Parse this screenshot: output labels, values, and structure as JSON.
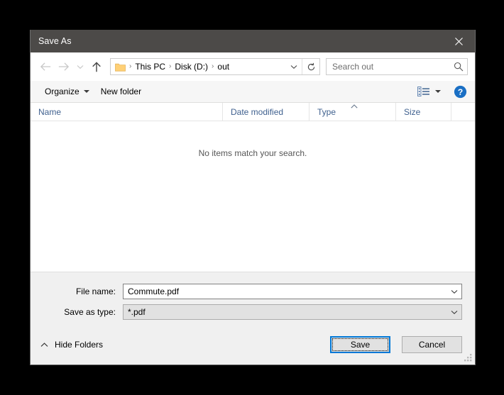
{
  "dialog": {
    "title": "Save As",
    "close_label": "Close"
  },
  "nav": {
    "back": "Back",
    "forward": "Forward",
    "recent": "Recent locations",
    "up": "Up one level"
  },
  "address": {
    "folder_icon": "folder-icon",
    "crumbs": [
      "This PC",
      "Disk (D:)",
      "out"
    ],
    "separator": "›",
    "dropdown": "Previous locations",
    "refresh": "Refresh"
  },
  "search": {
    "placeholder": "Search out",
    "icon": "search-icon"
  },
  "toolbar": {
    "organize_label": "Organize",
    "new_folder_label": "New folder",
    "view_icon": "list-view-icon",
    "help_label": "?"
  },
  "columns": [
    {
      "label": "Name"
    },
    {
      "label": "Date modified"
    },
    {
      "label": "Type"
    },
    {
      "label": "Size"
    }
  ],
  "filelist": {
    "empty_message": "No items match your search.",
    "items": []
  },
  "form": {
    "file_name_label": "File name:",
    "file_name_value": "Commute.pdf",
    "save_as_type_label": "Save as type:",
    "save_as_type_value": "*.pdf"
  },
  "footer": {
    "hide_folders_label": "Hide Folders",
    "save_label": "Save",
    "cancel_label": "Cancel"
  },
  "colors": {
    "titlebar": "#4c4a48",
    "accent": "#0078d7",
    "dialog_bg": "#f0f0f0",
    "column_header_text": "#40618f",
    "folder_yellow": "#ffd076"
  }
}
